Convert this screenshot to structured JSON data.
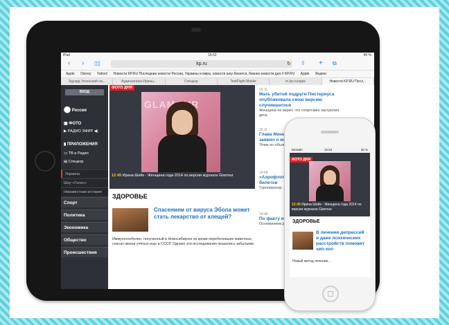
{
  "ipad": {
    "status": {
      "left": "iPad",
      "time": "16:52",
      "right": "45 %"
    },
    "url": "kp.ru",
    "bookmarks": [
      "Apple",
      "Disney",
      "Yahoo!",
      "Новости KP.RU Последние новости России, Украины и мира, новости шоу-бизнеса, бизнес-новости дня // KP.RU",
      "Apple",
      "Яндекс"
    ],
    "tabs": [
      "Эдуард Успенский на...",
      "Аудиозаписи Ирины...",
      "Спецкор",
      "TestFlight Mobile",
      "m.kp.ru/apps",
      "Новости KP.RU Посл..."
    ],
    "sidebar": {
      "login_label": "ВХОД",
      "region": "Россия",
      "photo": "ФОТО",
      "radio": "РАДИО ЭФИР",
      "apps": "ПРИЛОЖЕНИЯ",
      "tv": "ТВ и Радио",
      "speckor": "Спецкор",
      "subs": [
        "Украина",
        "Шоу «Голос»",
        "Неизвестная история"
      ],
      "categories": [
        "Спорт",
        "Политика",
        "Экономика",
        "Общество",
        "Происшествия"
      ]
    },
    "photo_day": {
      "badge": "ФОТО ДНЯ",
      "time": "12:49",
      "caption": "Ирина Шейк - Женщина года 2014 по версии журнала Glamour",
      "backdrop_text": "GLAMOUR"
    },
    "health": {
      "heading": "ЗДОРОВЬЕ",
      "title": "Спасением от вируса Эбола может стать лекарство от клещей?",
      "text": "Иммуноглобулин, полученный в Новосибирске из крови переболевших животных, спасал жизни учёных еще в СССР. Однако эти исследования оказались забытыми"
    },
    "news": [
      {
        "time": "15:11",
        "headline": "Мать убитой подруги Пистериуса опубликовала свою версию случившегося",
        "snippet": "Женщина не верит, что спортсмен застрелил дочь"
      },
      {
        "time": "15:11",
        "headline": "Глава Министерства Полторак заявил о военным давлении",
        "snippet": "Этим он объяснил..."
      },
      {
        "time": "14:58",
        "headline": "«Аэрофлот» и TEZ Tour от продажи билетов",
        "snippet": "Туроператор ... авиаперевозчик"
      },
      {
        "time": "14:46",
        "headline": "По факту в Москве во...",
        "snippet": "Основанием для ... стало"
      }
    ]
  },
  "iphone": {
    "status": {
      "carrier": "Билайн",
      "time": "15:52",
      "battery": "28 %"
    },
    "photo_day": {
      "badge": "ФОТО ДНЯ",
      "time": "12:49",
      "caption": "Ирина Шейк - Женщина года 2014 по версии журнала Glamour"
    },
    "health": {
      "heading": "ЗДОРОВЬЕ",
      "title": "В лечении депрессий и даже психических расстройств поможет хип-хоп",
      "text": "Новый метод лечения..."
    }
  }
}
